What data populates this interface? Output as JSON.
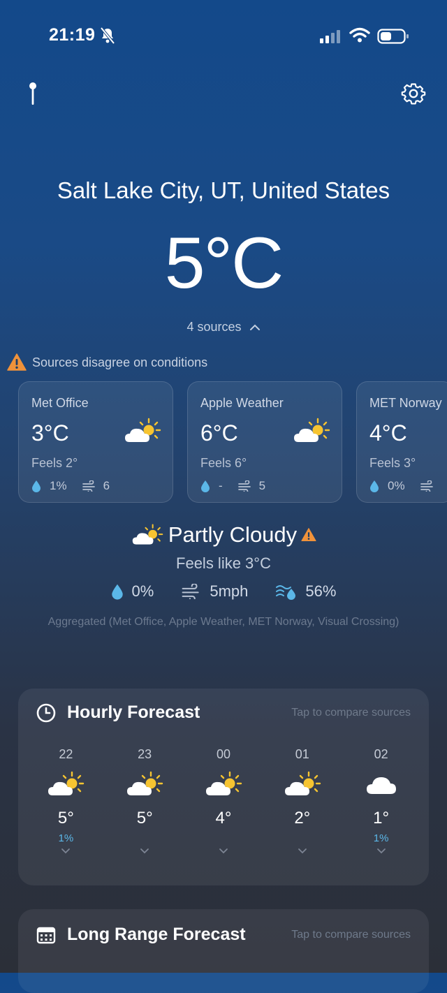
{
  "status_bar": {
    "time": "21:19"
  },
  "location": "Salt Lake City, UT, United States",
  "temperature": "5°C",
  "sources_toggle": "4 sources",
  "warning": "Sources disagree on conditions",
  "sources": [
    {
      "name": "Met Office",
      "temp": "3°C",
      "feels": "Feels 2°",
      "precip": "1%",
      "wind": "6",
      "icon": "partly-cloudy-icon"
    },
    {
      "name": "Apple Weather",
      "temp": "6°C",
      "feels": "Feels 6°",
      "precip": "-",
      "wind": "5",
      "icon": "partly-cloudy-icon"
    },
    {
      "name": "MET Norway",
      "temp": "4°C",
      "feels": "Feels 3°",
      "precip": "0%",
      "wind": "",
      "icon": ""
    }
  ],
  "condition": {
    "label": "Partly Cloudy",
    "feels_like": "Feels like 3°C",
    "precip": "0%",
    "wind": "5mph",
    "humidity": "56%"
  },
  "aggregated_note": "Aggregated (Met Office, Apple Weather, MET Norway, Visual Crossing)",
  "hourly": {
    "title": "Hourly Forecast",
    "hint": "Tap to compare sources",
    "hours": [
      {
        "hour": "22",
        "temp": "5°",
        "precip": "1%",
        "icon": "partly-cloudy-icon"
      },
      {
        "hour": "23",
        "temp": "5°",
        "precip": "",
        "icon": "partly-cloudy-icon"
      },
      {
        "hour": "00",
        "temp": "4°",
        "precip": "",
        "icon": "partly-cloudy-icon"
      },
      {
        "hour": "01",
        "temp": "2°",
        "precip": "",
        "icon": "partly-cloudy-icon"
      },
      {
        "hour": "02",
        "temp": "1°",
        "precip": "1%",
        "icon": "cloud-icon"
      }
    ]
  },
  "long_range": {
    "title": "Long Range Forecast",
    "hint": "Tap to compare sources"
  },
  "colors": {
    "precip_blue": "#5bb7e8",
    "warning_orange": "#f0923a",
    "sun_yellow": "#f6c431"
  }
}
